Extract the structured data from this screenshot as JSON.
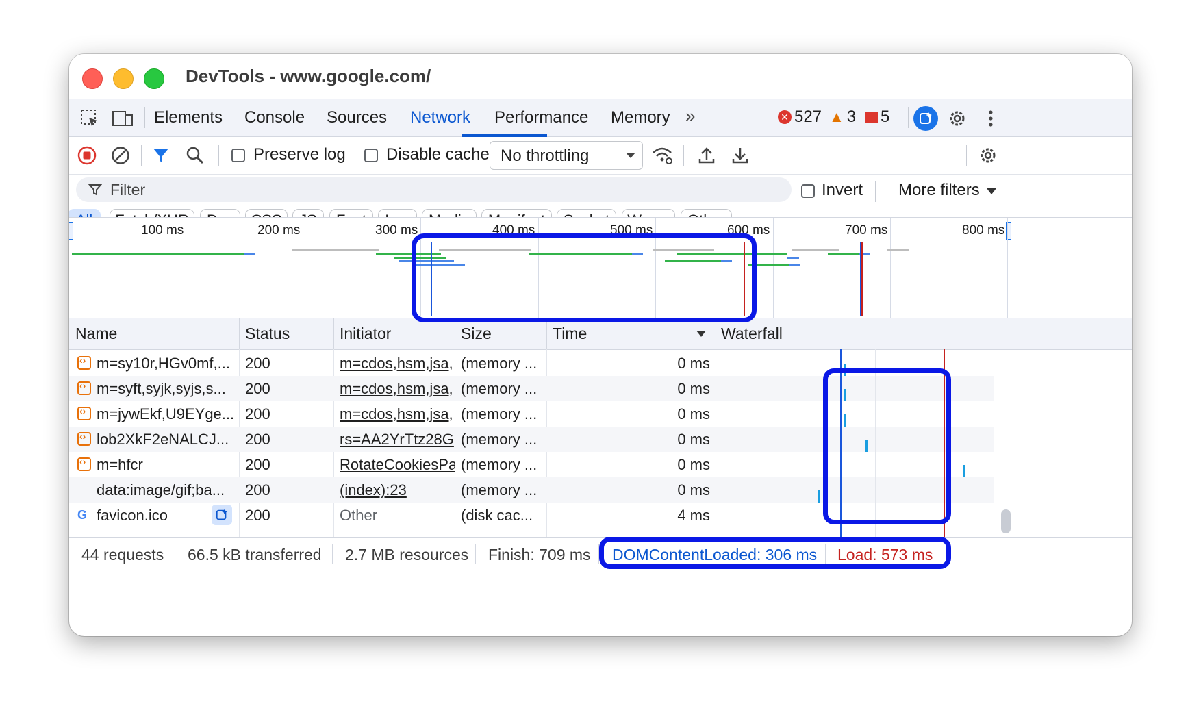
{
  "window": {
    "title": "DevTools - www.google.com/"
  },
  "tabs": [
    {
      "label": "Elements"
    },
    {
      "label": "Console"
    },
    {
      "label": "Sources"
    },
    {
      "label": "Network"
    },
    {
      "label": "Performance"
    },
    {
      "label": "Memory"
    }
  ],
  "active_tab": "Network",
  "counts": {
    "errors": "527",
    "warnings": "3",
    "issues": "5"
  },
  "toolbar": {
    "preserve_log": "Preserve log",
    "disable_cache": "Disable cache",
    "throttling": "No throttling"
  },
  "filter": {
    "placeholder": "Filter",
    "invert": "Invert",
    "more_filters": "More filters"
  },
  "chips": [
    "All",
    "Fetch/XHR",
    "Doc",
    "CSS",
    "JS",
    "Font",
    "Img",
    "Media",
    "Manifest",
    "Socket",
    "Wasm",
    "Other"
  ],
  "overview": {
    "ticks": [
      "100 ms",
      "200 ms",
      "300 ms",
      "400 ms",
      "500 ms",
      "600 ms",
      "700 ms",
      "800 ms"
    ]
  },
  "columns": {
    "name": "Name",
    "status": "Status",
    "initiator": "Initiator",
    "size": "Size",
    "time": "Time",
    "waterfall": "Waterfall"
  },
  "rows": [
    {
      "name": "m=sy10r,HGv0mf,...",
      "status": "200",
      "initiator": "m=cdos,hsm,jsa,",
      "size": "(memory ...",
      "time": "0 ms"
    },
    {
      "name": "m=syft,syjk,syjs,s...",
      "status": "200",
      "initiator": "m=cdos,hsm,jsa,",
      "size": "(memory ...",
      "time": "0 ms"
    },
    {
      "name": "m=jywEkf,U9EYge...",
      "status": "200",
      "initiator": "m=cdos,hsm,jsa,",
      "size": "(memory ...",
      "time": "0 ms"
    },
    {
      "name": "lob2XkF2eNALCJ...",
      "status": "200",
      "initiator": "rs=AA2YrTtz28G",
      "size": "(memory ...",
      "time": "0 ms"
    },
    {
      "name": "m=hfcr",
      "status": "200",
      "initiator": "RotateCookiesPa",
      "size": "(memory ...",
      "time": "0 ms"
    },
    {
      "name": "data:image/gif;ba...",
      "status": "200",
      "initiator": "(index):23",
      "size": "(memory ...",
      "time": "0 ms"
    },
    {
      "name": "favicon.ico",
      "status": "200",
      "initiator": "Other",
      "size": "(disk cac...",
      "time": "4 ms"
    }
  ],
  "status": {
    "requests": "44 requests",
    "transferred": "66.5 kB transferred",
    "resources": "2.7 MB resources",
    "finish": "Finish: 709 ms",
    "dcl": "DOMContentLoaded: 306 ms",
    "load": "Load: 573 ms"
  },
  "colors": {
    "accent": "#0b57d0",
    "dcl": "#0b57d0",
    "load": "#c5221f",
    "highlight": "#0a18e6"
  }
}
